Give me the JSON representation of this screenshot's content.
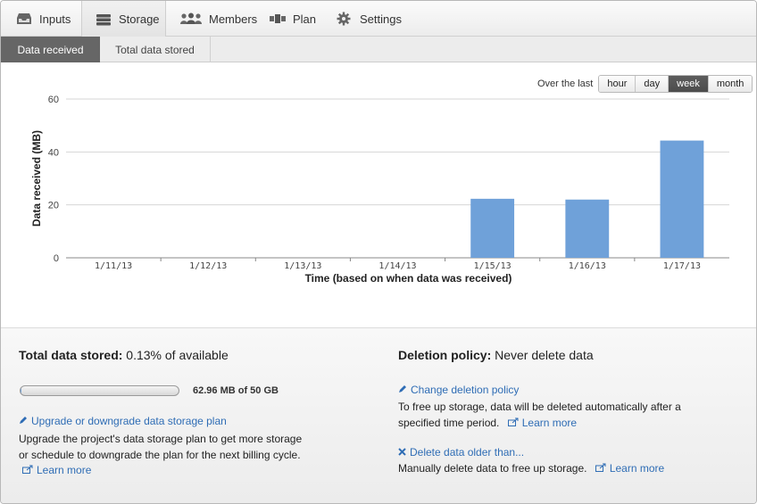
{
  "nav": {
    "items": [
      {
        "label": "Inputs",
        "icon": "inbox-icon"
      },
      {
        "label": "Storage",
        "icon": "storage-icon",
        "active": true
      },
      {
        "label": "Members",
        "icon": "people-icon"
      },
      {
        "label": "Plan",
        "icon": "plan-icon"
      },
      {
        "label": "Settings",
        "icon": "gear-icon"
      }
    ]
  },
  "subtabs": {
    "received": "Data received",
    "stored": "Total data stored",
    "active": "received"
  },
  "range": {
    "label": "Over the last",
    "options": [
      "hour",
      "day",
      "week",
      "month"
    ],
    "selected": "week"
  },
  "chart_data": {
    "type": "bar",
    "categories": [
      "1/11/13",
      "1/12/13",
      "1/13/13",
      "1/14/13",
      "1/15/13",
      "1/16/13",
      "1/17/13"
    ],
    "values": [
      0,
      0,
      0,
      0,
      22.3,
      22,
      44.3
    ],
    "xlabel": "Time (based on when data was received)",
    "ylabel": "Data received (MB)",
    "ylim": [
      0,
      60
    ],
    "yticks": [
      0,
      20,
      40,
      60
    ],
    "grid": true,
    "bar_color": "#6fa1d9"
  },
  "storage": {
    "title_bold": "Total data stored:",
    "title_rest": " 0.13% of available",
    "used_fraction": 0.0013,
    "usage_text": "62.96 MB of 50 GB",
    "upgrade_link": "Upgrade or downgrade data storage plan",
    "upgrade_desc_1": "Upgrade the project's data storage plan to get more storage",
    "upgrade_desc_2": "or schedule to downgrade the plan for the next billing cycle.",
    "learn_more": "Learn more"
  },
  "deletion": {
    "title_bold": "Deletion policy:",
    "title_rest": " Never delete data",
    "change_link": "Change deletion policy",
    "change_desc_1": "To free up storage, data will be deleted automatically after a",
    "change_desc_2": "specified time period.",
    "learn_more_1": "Learn more",
    "delete_link": "Delete data older than...",
    "delete_desc": "Manually delete data to free up storage.",
    "learn_more_2": "Learn more"
  },
  "colors": {
    "accent": "#2f6db5",
    "bar": "#6fa1d9",
    "active_tab": "#666666"
  }
}
